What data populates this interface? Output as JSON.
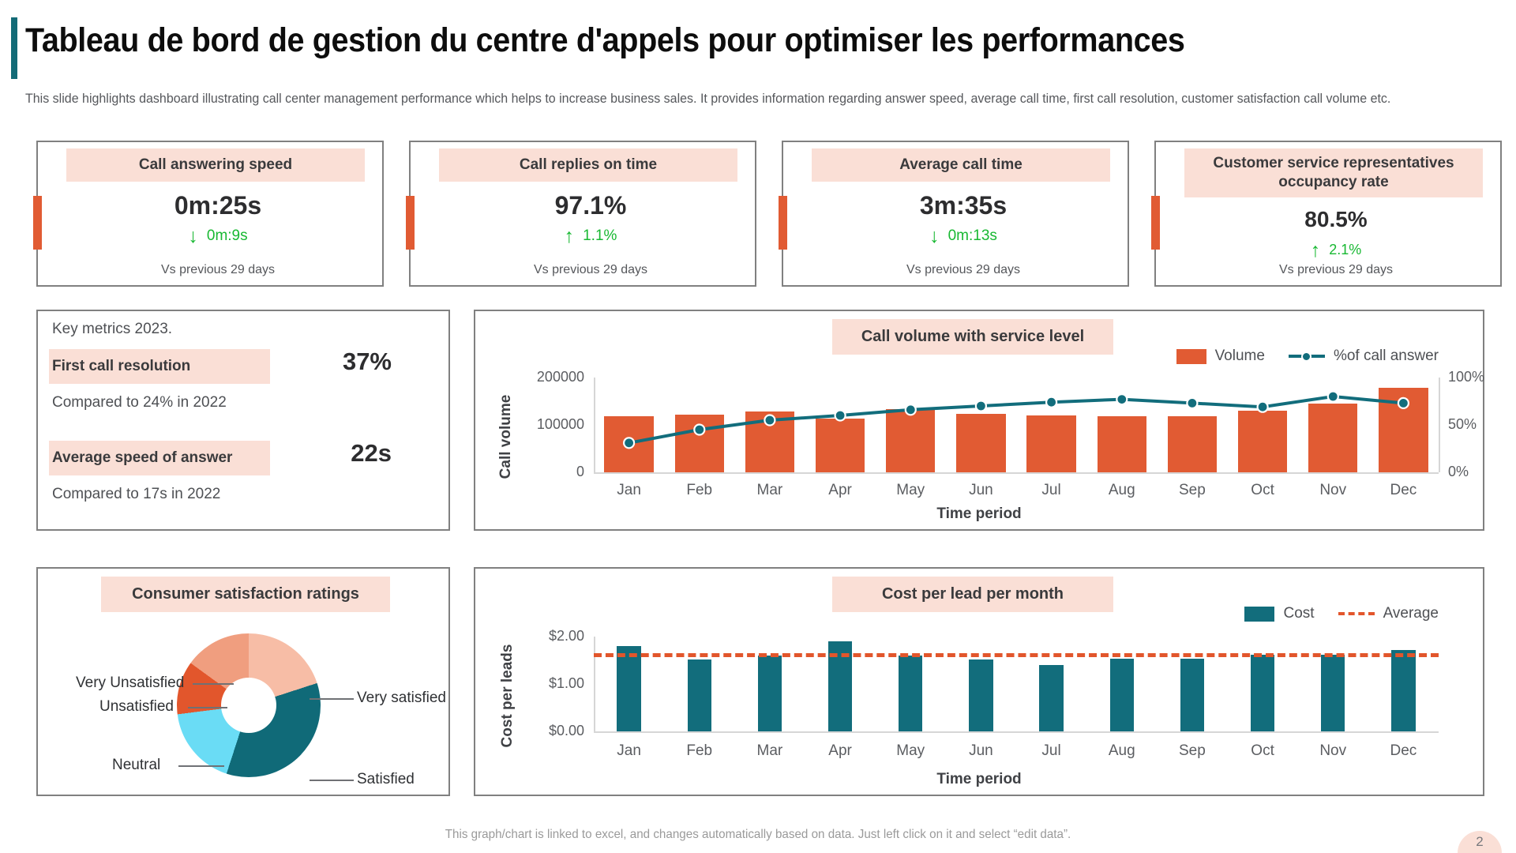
{
  "header": {
    "title": "Tableau de bord de gestion du centre d'appels pour optimiser les performances",
    "subtitle": "This slide highlights dashboard illustrating call center management performance which helps to increase business sales. It provides information regarding answer speed, average call time, first call resolution, customer satisfaction call volume etc."
  },
  "colors": {
    "orange": "#e15b33",
    "teal": "#126d7c",
    "peach_band": "#fadfd6",
    "green": "#18b832",
    "dashed_average": "#e2562c",
    "title_accent": "#136b77"
  },
  "kpis": [
    {
      "label": "Call answering speed",
      "value": "0m:25s",
      "delta": "0m:9s",
      "direction": "down",
      "note": "Vs previous 29 days"
    },
    {
      "label": "Call replies on time",
      "value": "97.1%",
      "delta": "1.1%",
      "direction": "up",
      "note": "Vs previous 29 days"
    },
    {
      "label": "Average call time",
      "value": "3m:35s",
      "delta": "0m:13s",
      "direction": "down",
      "note": "Vs previous 29 days"
    },
    {
      "label": "Customer service representatives occupancy rate",
      "value": "80.5%",
      "delta": "2.1%",
      "direction": "up",
      "note": "Vs previous 29 days"
    }
  ],
  "key_metrics": {
    "caption": "Key metrics 2023.",
    "rows": [
      {
        "label": "First call resolution",
        "value": "37%",
        "compare": "Compared to 24% in 2022"
      },
      {
        "label": "Average speed of answer",
        "value": "22s",
        "compare": "Compared to 17s in 2022"
      }
    ]
  },
  "volume_chart": {
    "title": "Call volume with service level",
    "legend": [
      "Volume",
      "%of call answer"
    ]
  },
  "satisfaction_chart": {
    "title": "Consumer satisfaction ratings"
  },
  "cost_chart": {
    "title": "Cost per lead per month",
    "legend": [
      "Cost",
      "Average"
    ]
  },
  "footer": {
    "note": "This graph/chart is linked to excel, and changes automatically based on data. Just left click on it and select “edit data”.",
    "page": "2"
  },
  "chart_data": [
    {
      "type": "bar",
      "id": "call-volume-with-service-level",
      "title": "Call volume with service level",
      "xlabel": "Time period",
      "ylabel": "Call volume",
      "categories": [
        "Jan",
        "Feb",
        "Mar",
        "Apr",
        "May",
        "Jun",
        "Jul",
        "Aug",
        "Sep",
        "Oct",
        "Nov",
        "Dec"
      ],
      "ylim": [
        0,
        200000
      ],
      "yticks": [
        "0",
        "100000",
        "200000"
      ],
      "y2lim": [
        0,
        100
      ],
      "y2ticks": [
        "0%",
        "50%",
        "100%"
      ],
      "grid": false,
      "legend_position": "top-right",
      "series": [
        {
          "name": "Volume",
          "type": "bar",
          "axis": "left",
          "color": "#e15b33",
          "values": [
            118000,
            121000,
            128000,
            113000,
            134000,
            124000,
            120000,
            118000,
            119000,
            130000,
            145000,
            178000
          ]
        },
        {
          "name": "%of call answer",
          "type": "line",
          "axis": "right",
          "color": "#126d7c",
          "values": [
            31,
            45,
            55,
            60,
            66,
            70,
            74,
            77,
            73,
            69,
            80,
            73
          ]
        }
      ]
    },
    {
      "type": "pie",
      "id": "consumer-satisfaction-ratings",
      "title": "Consumer satisfaction ratings",
      "labels": [
        "Very satisfied",
        "Satisfied",
        "Neutral",
        "Unsatisfied",
        "Very Unsatisfied"
      ],
      "values": [
        20,
        35,
        18,
        12,
        15
      ],
      "colors": [
        "#f7bda6",
        "#106a78",
        "#6adcf5",
        "#e2562c",
        "#f09e7f"
      ],
      "donut": true
    },
    {
      "type": "bar",
      "id": "cost-per-lead-per-month",
      "title": "Cost per lead per month",
      "xlabel": "Time period",
      "ylabel": "Cost per leads",
      "categories": [
        "Jan",
        "Feb",
        "Mar",
        "Apr",
        "May",
        "Jun",
        "Jul",
        "Aug",
        "Sep",
        "Oct",
        "Nov",
        "Dec"
      ],
      "ylim": [
        0,
        2
      ],
      "yticks": [
        "$0.00",
        "$1.00",
        "$2.00"
      ],
      "grid": false,
      "legend_position": "top-right",
      "series": [
        {
          "name": "Cost",
          "type": "bar",
          "color": "#126d7c",
          "values": [
            1.8,
            1.52,
            1.6,
            1.9,
            1.6,
            1.52,
            1.4,
            1.53,
            1.53,
            1.62,
            1.62,
            1.72
          ]
        },
        {
          "name": "Average",
          "type": "line",
          "style": "dashed",
          "color": "#e2562c",
          "value": 1.65
        }
      ]
    }
  ]
}
